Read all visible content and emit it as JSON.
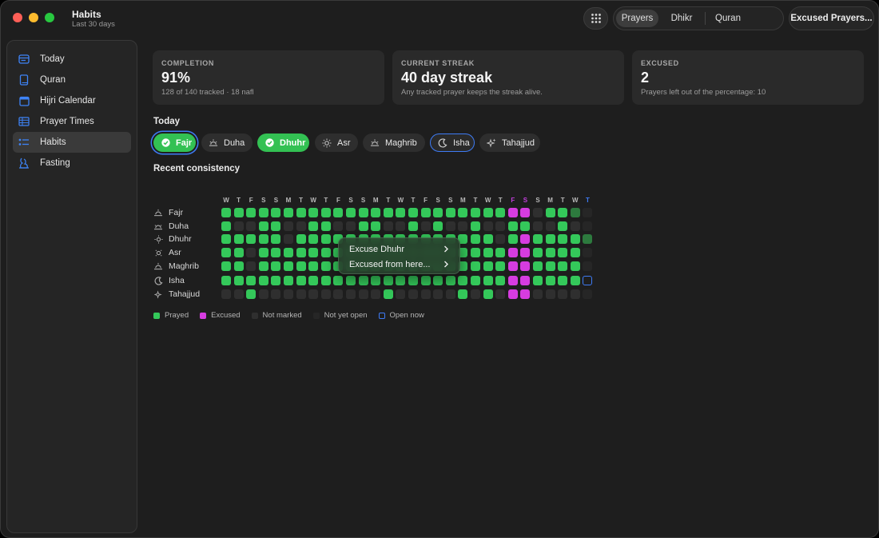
{
  "app": {
    "title": "Habits",
    "subtitle": "Last 30 days"
  },
  "toolbar": {
    "segments": [
      {
        "label": "Prayers",
        "active": true
      },
      {
        "label": "Dhikr",
        "active": false
      },
      {
        "label": "Quran",
        "active": false
      }
    ],
    "excused_button": "Excused Prayers..."
  },
  "sidebar": {
    "items": [
      {
        "label": "Today",
        "icon": "today-icon",
        "active": false
      },
      {
        "label": "Quran",
        "icon": "book-icon",
        "active": false
      },
      {
        "label": "Hijri Calendar",
        "icon": "calendar-icon",
        "active": false
      },
      {
        "label": "Prayer Times",
        "icon": "table-icon",
        "active": false
      },
      {
        "label": "Habits",
        "icon": "checklist-icon",
        "active": true
      },
      {
        "label": "Fasting",
        "icon": "fasting-icon",
        "active": false
      }
    ]
  },
  "cards": [
    {
      "label": "COMPLETION",
      "value": "91%",
      "sub": "128 of 140 tracked · 18 nafl"
    },
    {
      "label": "CURRENT STREAK",
      "value": "40 day streak",
      "sub": "Any tracked prayer keeps the streak alive."
    },
    {
      "label": "EXCUSED",
      "value": "2",
      "sub": "Prayers left out of the percentage: 10"
    }
  ],
  "today": {
    "title": "Today",
    "prayers": [
      {
        "label": "Fajr",
        "state": "done",
        "icon": "check-icon"
      },
      {
        "label": "Duha",
        "state": "pending",
        "icon": "sunrise-icon"
      },
      {
        "label": "Dhuhr",
        "state": "done",
        "icon": "check-icon"
      },
      {
        "label": "Asr",
        "state": "pending",
        "icon": "sun-icon"
      },
      {
        "label": "Maghrib",
        "state": "pending",
        "icon": "sunset-icon"
      },
      {
        "label": "Isha",
        "state": "open",
        "icon": "moon-icon"
      },
      {
        "label": "Tahajjud",
        "state": "pending",
        "icon": "sparkle-icon"
      }
    ]
  },
  "consistency": {
    "title": "Recent consistency",
    "day_labels": [
      "W",
      "T",
      "F",
      "S",
      "S",
      "M",
      "T",
      "W",
      "T",
      "F",
      "S",
      "S",
      "M",
      "T",
      "W",
      "T",
      "F",
      "S",
      "S",
      "M",
      "T",
      "W",
      "T",
      "F",
      "S",
      "S",
      "M",
      "T",
      "W",
      "T"
    ],
    "day_label_colors": {
      "23": "#c23fdc",
      "24": "#c23fdc",
      "29": "#3e7bf5"
    },
    "rows": [
      {
        "name": "Fajr",
        "icon": "sunrise-icon",
        "cells": "PPPPPPPPPPPPPPPPPPPPPPPEENPPD"
      },
      {
        "name": "Duha",
        "icon": "sunrise-icon",
        "cells": "PNNPPNNPPNNPPNNPNPNNPNNPPNNPN"
      },
      {
        "name": "Dhuhr",
        "icon": "sun-icon",
        "cells": "PPPPPNPPPPPPPPPPPPPPPPNPEPPPPD"
      },
      {
        "name": "Asr",
        "icon": "sun-icon",
        "cells": "PPNPPPPPPPPPPPPPPPPPPPPEEPPPPX"
      },
      {
        "name": "Maghrib",
        "icon": "sunset-icon",
        "cells": "PPNPPPPPPPPPPPPPPPPPPPPEEPPPPX"
      },
      {
        "name": "Isha",
        "icon": "moon-icon",
        "cells": "PPPPPPPPPPPPPPPPPPPPPPPEEPPPPO"
      },
      {
        "name": "Tahajjud",
        "icon": "sparkle-icon",
        "cells": "NNPNNNNNNNNNNPNNNNNPNPNEENNNNX"
      }
    ],
    "legend": [
      {
        "label": "Prayed",
        "color": "#34c85a"
      },
      {
        "label": "Excused",
        "color": "#d63ce0"
      },
      {
        "label": "Not marked",
        "color": "#2f2f2f"
      },
      {
        "label": "Not yet open",
        "color": "#262626"
      },
      {
        "label": "Open now",
        "color": "#3e7bf5"
      }
    ]
  },
  "context_menu": {
    "items": [
      {
        "label": "Excuse Dhuhr"
      },
      {
        "label": "Excused from here..."
      }
    ]
  }
}
